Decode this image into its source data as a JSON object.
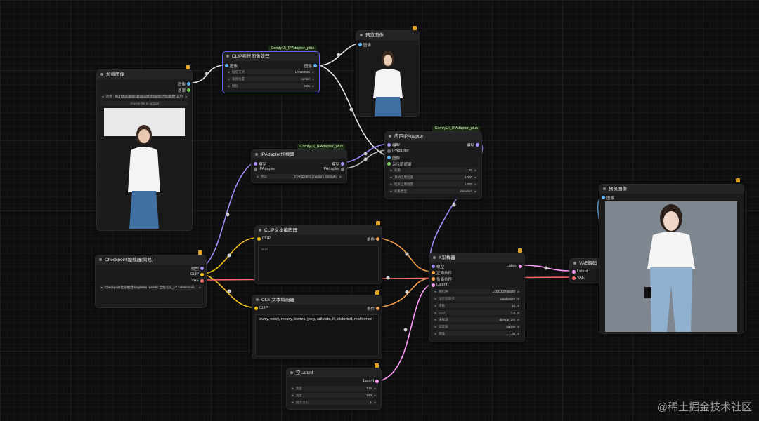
{
  "canvas": {
    "background": "#0f0f10"
  },
  "colors": {
    "model": "#a78bfa",
    "clip": "#f5c518",
    "vae": "#ff6b6b",
    "conditioning": "#f7a04b",
    "latent": "#ff9cf9",
    "image": "#64b5f6",
    "ipadapter": "#777777",
    "selected": "#5a63ff"
  },
  "nodes": {
    "load_image": {
      "title": "加载图像",
      "outputs": [
        "图像",
        "遮罩"
      ],
      "widget_key": "图像",
      "widget_value": "8c57260d58b0d2c8ed0f4f2b600c7f032bff71e.73.jpg",
      "upload_label": "choose file to upload"
    },
    "clip_vision_prep": {
      "title": "CLIP视觉图像处理",
      "badge": "ComfyUI_IPAdapter_plus",
      "input": "图像",
      "output": "图像",
      "widgets": [
        {
          "key": "插值方式",
          "value": "LANCZOS"
        },
        {
          "key": "裁剪位置",
          "value": "center"
        },
        {
          "key": "锐化",
          "value": "0.05"
        }
      ]
    },
    "preview_top": {
      "title": "预览图像",
      "input": "图像"
    },
    "ipadapter_loader": {
      "title": "IPAdapter加载器",
      "badge": "ComfyUI_IPAdapter_plus",
      "inputs": [
        "模型",
        "IPAdapter"
      ],
      "outputs": [
        "模型",
        "IPAdapter"
      ],
      "widget_key": "预设",
      "widget_value": "STANDARD (medium strength)"
    },
    "apply_ipadapter": {
      "title": "应用IPAdapter",
      "badge": "ComfyUI_IPAdapter_plus",
      "inputs": [
        "模型",
        "IPAdapter",
        "图像",
        "关注层遮罩"
      ],
      "output": "模型",
      "widgets": [
        {
          "key": "权重",
          "value": "1.00"
        },
        {
          "key": "开始应用位置",
          "value": "0.000"
        },
        {
          "key": "结束应用位置",
          "value": "1.000"
        },
        {
          "key": "权重类型",
          "value": "standard"
        }
      ]
    },
    "checkpoint": {
      "title": "Checkpoint加载器(简易)",
      "outputs": [
        "模型",
        "CLIP",
        "VAE"
      ],
      "widget_value": "Checkpoint比较组合SingleMix realistic 全能写实_v7.safetensors"
    },
    "clip_pos": {
      "title": "CLIP文本编码器",
      "input": "CLIP",
      "output": "条件",
      "text": "text"
    },
    "clip_neg": {
      "title": "CLIP文本编码器",
      "input": "CLIP",
      "output": "条件",
      "text": "blurry, noisy, messy, lowres, jpeg, artifacts, ill, distorted, malformed"
    },
    "empty_latent": {
      "title": "空Latent",
      "output": "Latent",
      "widgets": [
        {
          "key": "宽度",
          "value": "512"
        },
        {
          "key": "高度",
          "value": "640"
        },
        {
          "key": "批次大小",
          "value": "1"
        }
      ]
    },
    "ksampler": {
      "title": "K采样器",
      "inputs": [
        "模型",
        "正面条件",
        "负面条件",
        "Latent"
      ],
      "output": "Latent",
      "widgets": [
        {
          "key": "随机种",
          "value": "1463183785620"
        },
        {
          "key": "运行后操作",
          "value": "randomize"
        },
        {
          "key": "步数",
          "value": "20"
        },
        {
          "key": "CFG",
          "value": "7.0"
        },
        {
          "key": "采样器",
          "value": "dpmpp_2m"
        },
        {
          "key": "调度器",
          "value": "karras"
        },
        {
          "key": "降噪",
          "value": "1.00"
        }
      ]
    },
    "vae_decode": {
      "title": "VAE解码",
      "inputs": [
        "Latent",
        "VAE"
      ]
    },
    "preview_final": {
      "title": "预览图像",
      "input": "图像"
    }
  },
  "watermark": "@稀土掘金技术社区"
}
